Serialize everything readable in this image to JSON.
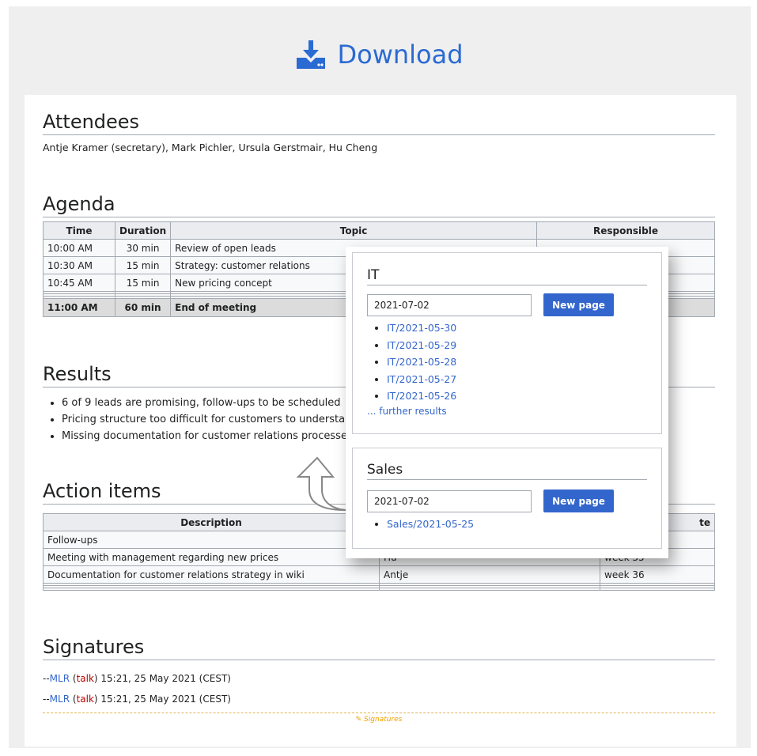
{
  "download": {
    "label": "Download",
    "icon": "download-icon",
    "color": "#2a6ad3"
  },
  "attendees": {
    "heading": "Attendees",
    "text": "Antje Kramer (secretary), Mark Pichler, Ursula Gerstmair, Hu Cheng"
  },
  "agenda": {
    "heading": "Agenda",
    "columns": [
      "Time",
      "Duration",
      "Topic",
      "Responsible"
    ],
    "rows": [
      {
        "time": "10:00 AM",
        "duration": "30 min",
        "topic": "Review of open leads",
        "responsible": ""
      },
      {
        "time": "10:30 AM",
        "duration": "15 min",
        "topic": "Strategy: customer relations",
        "responsible": ""
      },
      {
        "time": "10:45 AM",
        "duration": "15 min",
        "topic": "New pricing concept",
        "responsible": ""
      }
    ],
    "total": {
      "time": "11:00 AM",
      "duration": "60 min",
      "topic": "End of meeting"
    }
  },
  "results": {
    "heading": "Results",
    "items": [
      "6 of 9 leads are promising, follow-ups to be scheduled",
      "Pricing structure too difficult for customers to understand",
      "Missing documentation for customer relations processes"
    ]
  },
  "actions": {
    "heading": "Action items",
    "columns": [
      "Description",
      "",
      "te"
    ],
    "rows": [
      {
        "description": "Follow-ups",
        "who": "",
        "date": ""
      },
      {
        "description": "Meeting with management regarding new prices",
        "who": "Hu",
        "date": "week 35"
      },
      {
        "description": "Documentation for customer relations strategy in wiki",
        "who": "Antje",
        "date": "week 36"
      }
    ]
  },
  "signatures": {
    "heading": "Signatures",
    "lines": [
      {
        "prefix": "--",
        "user": "MLR",
        "talk": "talk",
        "stamp": "15:21, 25 May 2021 (CEST)"
      },
      {
        "prefix": "--",
        "user": "MLR",
        "talk": "talk",
        "stamp": "15:21, 25 May 2021 (CEST)"
      }
    ],
    "tag": "Signatures",
    "tag_icon": "pen-icon"
  },
  "popup": {
    "it": {
      "title": "IT",
      "input_value": "2021-07-02",
      "button": "New page",
      "links": [
        "IT/2021-05-30",
        "IT/2021-05-29",
        "IT/2021-05-28",
        "IT/2021-05-27",
        "IT/2021-05-26"
      ],
      "more": "... further results"
    },
    "sales": {
      "title": "Sales",
      "input_value": "2021-07-02",
      "button": "New page",
      "links": [
        "Sales/2021-05-25"
      ]
    },
    "accent": "#3366cc"
  }
}
